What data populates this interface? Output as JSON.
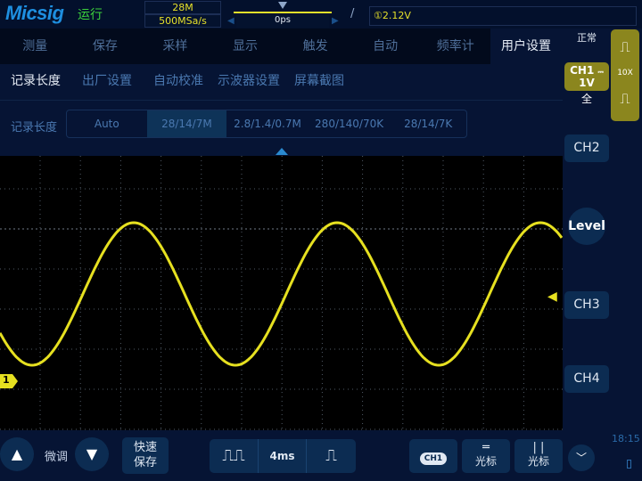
{
  "header": {
    "brand": "Micsig",
    "run_state": "运行",
    "memory_depth": "28M",
    "sample_rate": "500MSa/s",
    "trigger_position": "0ps",
    "trigger_slope_icon": "rising-edge-icon",
    "trigger_level": "①2.12V"
  },
  "menu": {
    "items": [
      "测量",
      "保存",
      "采样",
      "显示",
      "触发",
      "自动",
      "频率计"
    ],
    "active": "用户设置"
  },
  "submenu": {
    "items": [
      "记录长度",
      "出厂设置",
      "自动校准",
      "示波器设置",
      "屏幕截图"
    ],
    "active_index": 0
  },
  "record_length": {
    "label": "记录长度",
    "options": [
      "Auto",
      "28/14/7M",
      "2.8/1.4/0.7M",
      "280/140/70K",
      "28/14/7K"
    ],
    "selected": "28/14/7M"
  },
  "right_panel": {
    "acq_mode": "正常",
    "ch1_label": "CH1",
    "ch1_coupling": "⎓",
    "ch1_scale": "1V",
    "bandwidth": "全",
    "probe": "10X",
    "ch2": "CH2",
    "level": "Level",
    "ch3": "CH3",
    "ch4": "CH4"
  },
  "waveform": {
    "channel": "1",
    "color": "#e6e020",
    "shape": "sine"
  },
  "bottom": {
    "fine": "微调",
    "quick_save_line1": "快速",
    "quick_save_line2": "保存",
    "timebase": "4ms",
    "ch1_badge": "CH1",
    "cursor_h": "光标",
    "cursor_v": "光标",
    "time": "18:15"
  },
  "colors": {
    "accent": "#0c2c52",
    "channel1": "#e6e020",
    "run": "#3cd23c"
  }
}
